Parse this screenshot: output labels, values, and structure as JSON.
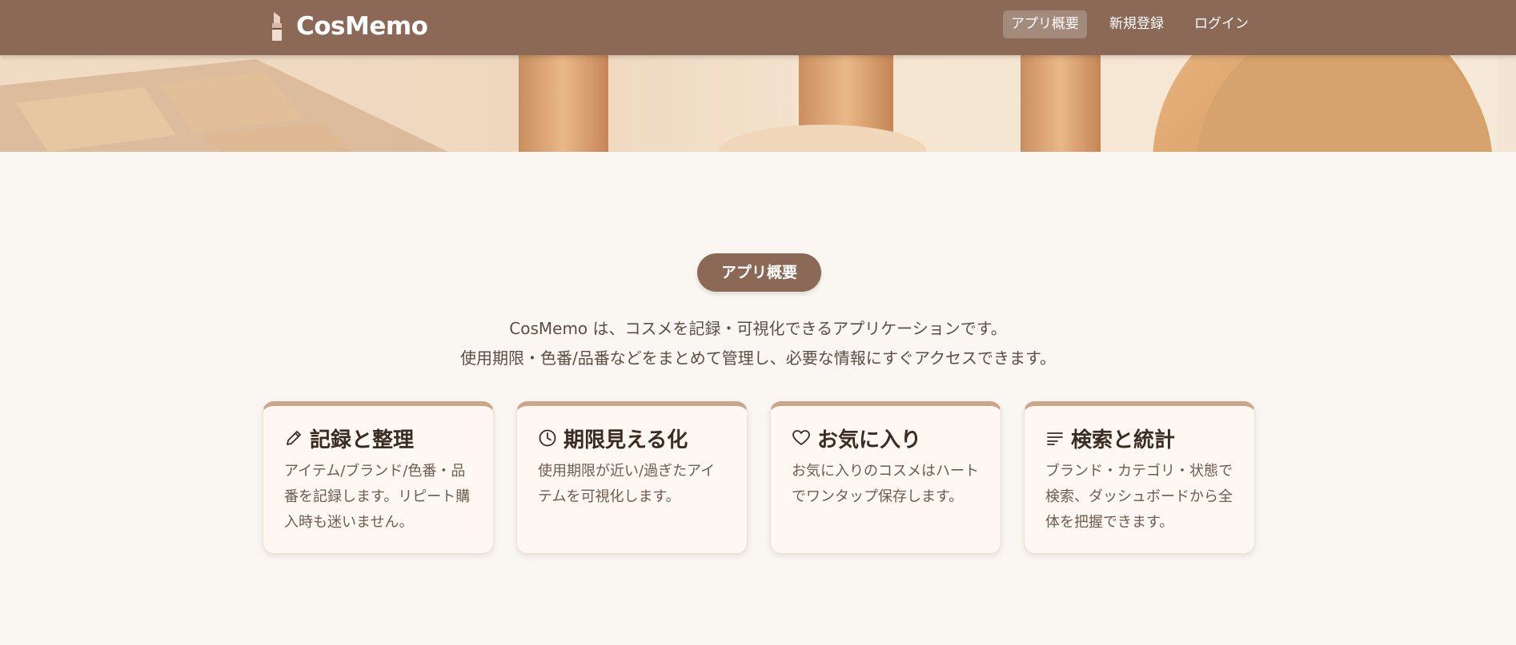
{
  "header": {
    "brand": "CosMemo",
    "nav": [
      {
        "label": "アプリ概要"
      },
      {
        "label": "新規登録"
      },
      {
        "label": "ログイン"
      }
    ]
  },
  "icons": {
    "brand": "lipstick-icon",
    "cards": [
      "pencil-icon",
      "clock-icon",
      "heart-icon",
      "list-icon"
    ]
  },
  "colors": {
    "header": "#8b6956",
    "background": "#faf7f3",
    "card_accent": "#c9a78b"
  },
  "main": {
    "section_label": "アプリ概要",
    "intro_line1": "CosMemo は、コスメを記録・可視化できるアプリケーションです。",
    "intro_line2": "使用期限・色番/品番などをまとめて管理し、必要な情報にすぐアクセスできます。",
    "cards": [
      {
        "title": "記録と整理",
        "body": "アイテム/ブランド/色番・品番を記録します。リピート購入時も迷いません。"
      },
      {
        "title": "期限見える化",
        "body": "使用期限が近い/過ぎたアイテムを可視化します。"
      },
      {
        "title": "お気に入り",
        "body": "お気に入りのコスメはハートでワンタップ保存します。"
      },
      {
        "title": "検索と統計",
        "body": "ブランド・カテゴリ・状態で検索、ダッシュボードから全体を把握できます。"
      }
    ]
  }
}
